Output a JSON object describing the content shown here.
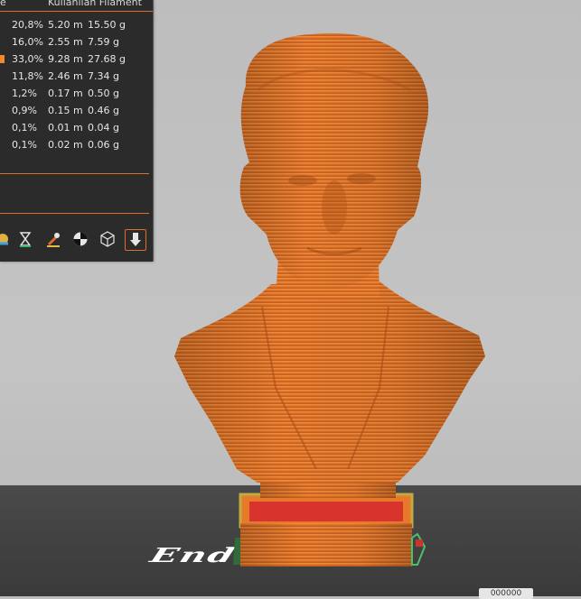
{
  "stats_panel": {
    "columns": {
      "partial_left": "e",
      "used_filament": "Kullanılan Filament"
    },
    "rows": [
      {
        "percent": "20,8%",
        "length": "5.20 m",
        "weight": "15.50 g",
        "color": ""
      },
      {
        "percent": "16,0%",
        "length": "2.55 m",
        "weight": "7.59 g",
        "color": ""
      },
      {
        "percent": "33,0%",
        "length": "9.28 m",
        "weight": "27.68 g",
        "color": "#f28a2d"
      },
      {
        "percent": "11,8%",
        "length": "2.46 m",
        "weight": "7.34 g",
        "color": ""
      },
      {
        "percent": "1,2%",
        "length": "0.17 m",
        "weight": "0.50 g",
        "color": ""
      },
      {
        "percent": "0,9%",
        "length": "0.15 m",
        "weight": "0.46 g",
        "color": ""
      },
      {
        "percent": "0,1%",
        "length": "0.01 m",
        "weight": "0.04 g",
        "color": ""
      },
      {
        "percent": "0,1%",
        "length": "0.02 m",
        "weight": "0.06 g",
        "color": ""
      }
    ],
    "toolbar": [
      {
        "icon": "feature-type-icon"
      },
      {
        "icon": "hourglass-icon"
      },
      {
        "icon": "tool-color-icon"
      },
      {
        "icon": "extrusion-role-icon"
      },
      {
        "icon": "cube-outline-icon"
      },
      {
        "icon": "download-export-icon"
      }
    ]
  },
  "viewport": {
    "bed_logo_text": "Ender",
    "corner_label": "000000"
  },
  "colors": {
    "panel_bg": "#2b2b2b",
    "accent": "#e06c2d",
    "model_orange": "#e7792a"
  }
}
